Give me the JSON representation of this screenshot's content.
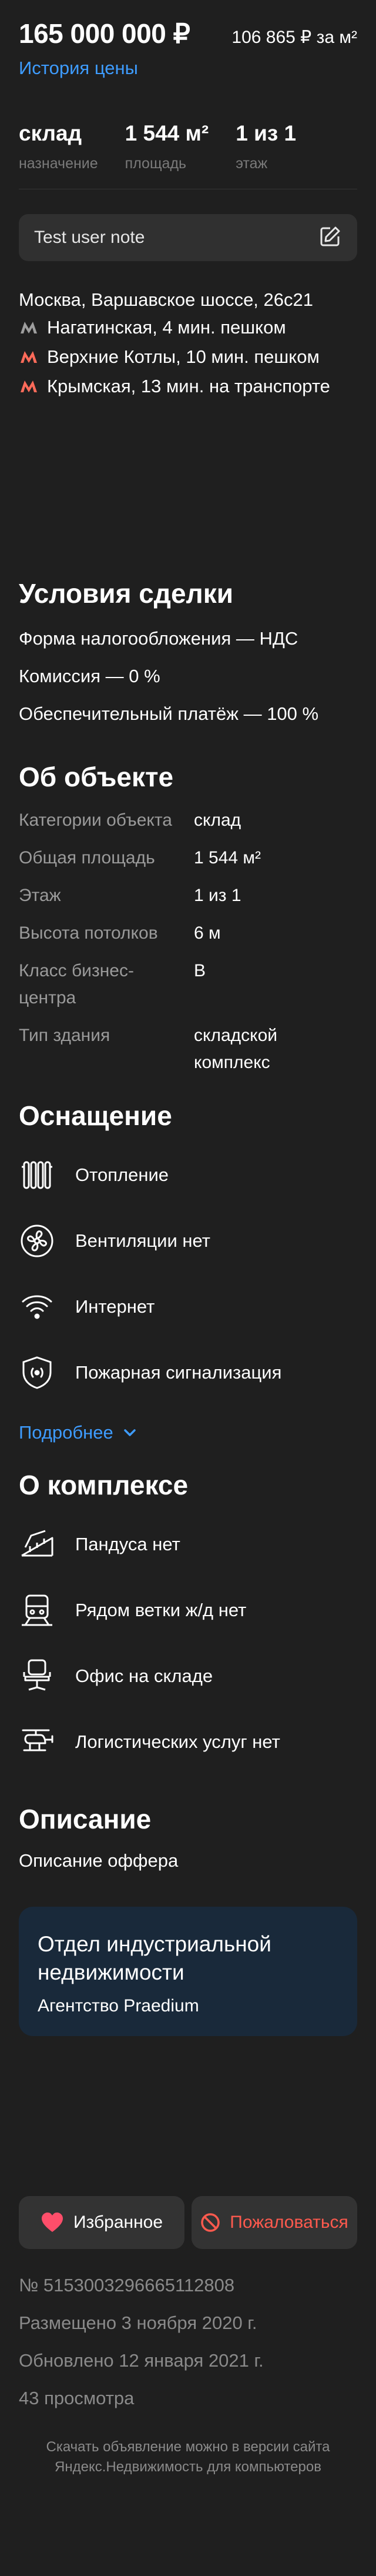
{
  "price": {
    "total": "165 000 000 ₽",
    "per_sqm": "106 865 ₽ за м²",
    "history_link": "История цены"
  },
  "stats": [
    {
      "value": "склад",
      "label": "назначение"
    },
    {
      "value": "1 544 м²",
      "label": "площадь"
    },
    {
      "value": "1 из 1",
      "label": "этаж"
    }
  ],
  "note": {
    "text": "Test user note",
    "icon": "edit-icon"
  },
  "location": {
    "address": "Москва, Варшавское шоссе, 26с21",
    "metro": [
      {
        "text": "Нагатинская, 4 мин. пешком",
        "color": "#9e9e9e"
      },
      {
        "text": "Верхние Котлы, 10 мин. пешком",
        "color": "#ff6b5a"
      },
      {
        "text": "Крымская, 13 мин. на транспорте",
        "color": "#ff6b5a"
      }
    ]
  },
  "deal": {
    "title": "Условия сделки",
    "items": [
      "Форма налогообложения — НДС",
      "Комиссия — 0 %",
      "Обеспечительный платёж — 100 %"
    ]
  },
  "object": {
    "title": "Об объекте",
    "rows": [
      {
        "key": "Категории объекта",
        "value": "склад"
      },
      {
        "key": "Общая площадь",
        "value": "1 544 м²"
      },
      {
        "key": "Этаж",
        "value": "1 из 1"
      },
      {
        "key": "Высота потолков",
        "value": "6 м"
      },
      {
        "key": "Класс бизнес-центра",
        "value": "B"
      },
      {
        "key": "Тип здания",
        "value": "складской комплекс"
      }
    ]
  },
  "equipment": {
    "title": "Оснащение",
    "items": [
      {
        "label": "Отопление",
        "icon": "radiator-icon"
      },
      {
        "label": "Вентиляции нет",
        "icon": "fan-icon"
      },
      {
        "label": "Интернет",
        "icon": "wifi-icon"
      },
      {
        "label": "Пожарная сигнализация",
        "icon": "fire-alarm-icon"
      }
    ],
    "more_link": "Подробнее"
  },
  "complex": {
    "title": "О комплексе",
    "items": [
      {
        "label": "Пандуса нет",
        "icon": "ramp-icon"
      },
      {
        "label": "Рядом ветки ж/д нет",
        "icon": "train-icon"
      },
      {
        "label": "Офис на складе",
        "icon": "office-chair-icon"
      },
      {
        "label": "Логистических услуг нет",
        "icon": "helicopter-icon"
      }
    ]
  },
  "description": {
    "title": "Описание",
    "text": "Описание оффера"
  },
  "agency": {
    "title": "Отдел индустриальной недвижимости",
    "subtitle": "Агентство Praedium"
  },
  "actions": {
    "favorite": "Избранное",
    "complain": "Пожаловаться"
  },
  "meta": {
    "id": "№ 5153003296665112808",
    "posted": "Размещено 3 ноября 2020 г.",
    "updated": "Обновлено 12 января 2021 г.",
    "views": "43 просмотра"
  },
  "footer": {
    "line1": "Скачать объявление можно в версии сайта",
    "line2": "Яндекс.Недвижимость для компьютеров"
  }
}
